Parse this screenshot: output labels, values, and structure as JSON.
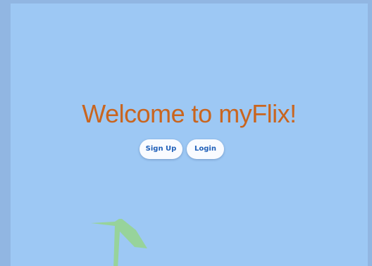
{
  "welcome": {
    "title": "Welcome to myFlix!"
  },
  "actions": {
    "signup_label": "Sign Up",
    "login_label": "Login"
  },
  "colors": {
    "outer_background": "#91b6e2",
    "page_background": "#9dc8f4",
    "title_color": "#c9651f",
    "button_background": "#f9fbff",
    "button_text": "#1f5fb8",
    "decoration_green": "#97d39b"
  },
  "icons": {
    "decoration": "palm-tree-icon"
  }
}
